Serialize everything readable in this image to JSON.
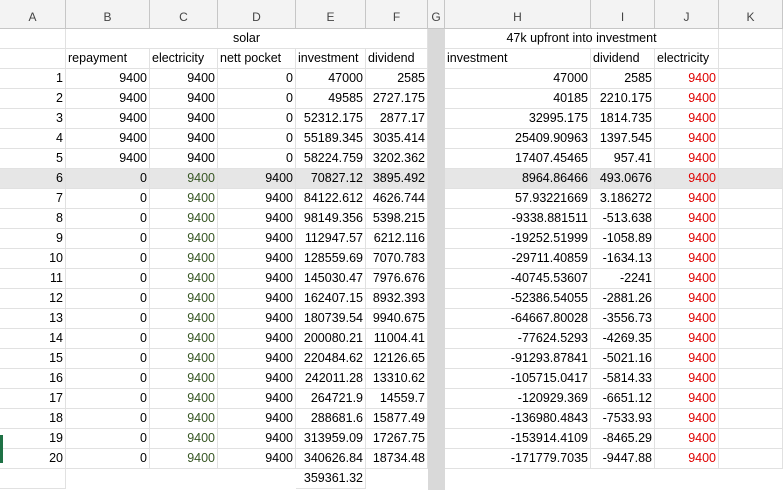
{
  "columns": [
    "A",
    "B",
    "C",
    "D",
    "E",
    "F",
    "G",
    "H",
    "I",
    "J",
    "K"
  ],
  "merged_titles": {
    "solar": "solar",
    "upfront": "47k upfront into investment"
  },
  "headers": {
    "b": "repayment",
    "c": "electricity",
    "d": "nett pocket",
    "e": "investment",
    "f": "dividend",
    "h": "investment",
    "i": "dividend",
    "j": "electricity"
  },
  "rows": [
    {
      "a": "1",
      "b": "9400",
      "c": "9400",
      "d": "0",
      "e": "47000",
      "f": "2585",
      "h": "47000",
      "i": "2585",
      "j": "9400"
    },
    {
      "a": "2",
      "b": "9400",
      "c": "9400",
      "d": "0",
      "e": "49585",
      "f": "2727.175",
      "h": "40185",
      "i": "2210.175",
      "j": "9400"
    },
    {
      "a": "3",
      "b": "9400",
      "c": "9400",
      "d": "0",
      "e": "52312.175",
      "f": "2877.17",
      "h": "32995.175",
      "i": "1814.735",
      "j": "9400"
    },
    {
      "a": "4",
      "b": "9400",
      "c": "9400",
      "d": "0",
      "e": "55189.345",
      "f": "3035.414",
      "h": "25409.90963",
      "i": "1397.545",
      "j": "9400"
    },
    {
      "a": "5",
      "b": "9400",
      "c": "9400",
      "d": "0",
      "e": "58224.759",
      "f": "3202.362",
      "h": "17407.45465",
      "i": "957.41",
      "j": "9400"
    },
    {
      "a": "6",
      "b": "0",
      "c": "9400",
      "d": "9400",
      "e": "70827.12",
      "f": "3895.492",
      "h": "8964.86466",
      "i": "493.0676",
      "j": "9400"
    },
    {
      "a": "7",
      "b": "0",
      "c": "9400",
      "d": "9400",
      "e": "84122.612",
      "f": "4626.744",
      "h": "57.93221669",
      "i": "3.186272",
      "j": "9400"
    },
    {
      "a": "8",
      "b": "0",
      "c": "9400",
      "d": "9400",
      "e": "98149.356",
      "f": "5398.215",
      "h": "-9338.881511",
      "i": "-513.638",
      "j": "9400"
    },
    {
      "a": "9",
      "b": "0",
      "c": "9400",
      "d": "9400",
      "e": "112947.57",
      "f": "6212.116",
      "h": "-19252.51999",
      "i": "-1058.89",
      "j": "9400"
    },
    {
      "a": "10",
      "b": "0",
      "c": "9400",
      "d": "9400",
      "e": "128559.69",
      "f": "7070.783",
      "h": "-29711.40859",
      "i": "-1634.13",
      "j": "9400"
    },
    {
      "a": "11",
      "b": "0",
      "c": "9400",
      "d": "9400",
      "e": "145030.47",
      "f": "7976.676",
      "h": "-40745.53607",
      "i": "-2241",
      "j": "9400"
    },
    {
      "a": "12",
      "b": "0",
      "c": "9400",
      "d": "9400",
      "e": "162407.15",
      "f": "8932.393",
      "h": "-52386.54055",
      "i": "-2881.26",
      "j": "9400"
    },
    {
      "a": "13",
      "b": "0",
      "c": "9400",
      "d": "9400",
      "e": "180739.54",
      "f": "9940.675",
      "h": "-64667.80028",
      "i": "-3556.73",
      "j": "9400"
    },
    {
      "a": "14",
      "b": "0",
      "c": "9400",
      "d": "9400",
      "e": "200080.21",
      "f": "11004.41",
      "h": "-77624.5293",
      "i": "-4269.35",
      "j": "9400"
    },
    {
      "a": "15",
      "b": "0",
      "c": "9400",
      "d": "9400",
      "e": "220484.62",
      "f": "12126.65",
      "h": "-91293.87841",
      "i": "-5021.16",
      "j": "9400"
    },
    {
      "a": "16",
      "b": "0",
      "c": "9400",
      "d": "9400",
      "e": "242011.28",
      "f": "13310.62",
      "h": "-105715.0417",
      "i": "-5814.33",
      "j": "9400"
    },
    {
      "a": "17",
      "b": "0",
      "c": "9400",
      "d": "9400",
      "e": "264721.9",
      "f": "14559.7",
      "h": "-120929.369",
      "i": "-6651.12",
      "j": "9400"
    },
    {
      "a": "18",
      "b": "0",
      "c": "9400",
      "d": "9400",
      "e": "288681.6",
      "f": "15877.49",
      "h": "-136980.4843",
      "i": "-7533.93",
      "j": "9400"
    },
    {
      "a": "19",
      "b": "0",
      "c": "9400",
      "d": "9400",
      "e": "313959.09",
      "f": "17267.75",
      "h": "-153914.4109",
      "i": "-8465.29",
      "j": "9400"
    },
    {
      "a": "20",
      "b": "0",
      "c": "9400",
      "d": "9400",
      "e": "340626.84",
      "f": "18734.48",
      "h": "-171779.7035",
      "i": "-9447.88",
      "j": "9400"
    }
  ],
  "footer": {
    "e": "359361.32"
  },
  "colors": {
    "green_text": "#375623",
    "red_text": "#e00000",
    "selected_row_fill": "#e6e6e6",
    "gridline": "#e1e1e1"
  },
  "selected_row": 6
}
